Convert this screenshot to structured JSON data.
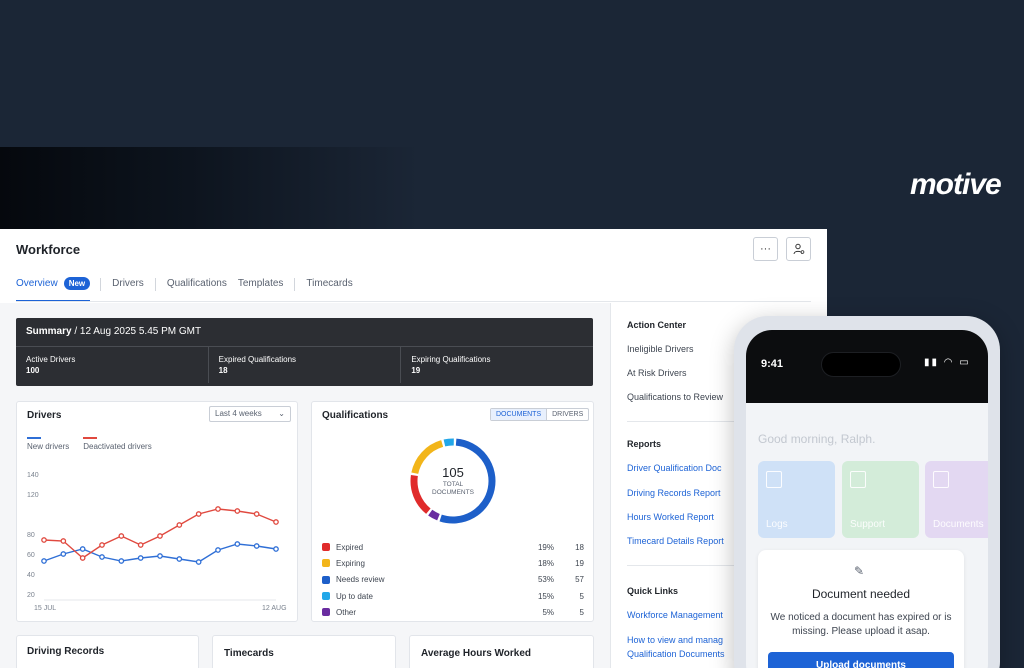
{
  "brand": {
    "logo_text": "motive"
  },
  "workforce": {
    "title": "Workforce",
    "more_label": "···",
    "tabs": [
      {
        "label": "Overview",
        "badge": "New",
        "active": true
      },
      {
        "label": "Drivers"
      },
      {
        "label": "Qualifications"
      },
      {
        "label": "Templates"
      },
      {
        "label": "Timecards"
      }
    ]
  },
  "summary": {
    "title": "Summary",
    "timestamp": " / 12 Aug 2025 5.45 PM GMT",
    "stats": [
      {
        "label": "Active Drivers",
        "value": "100"
      },
      {
        "label": "Expired Qualifications",
        "value": "18"
      },
      {
        "label": "Expiring Qualifications",
        "value": "19"
      }
    ]
  },
  "drivers_card": {
    "title": "Drivers",
    "range_select": "Last 4 weeks",
    "legend": [
      {
        "label": "New drivers",
        "color": "#2f6fd6"
      },
      {
        "label": "Deactivated drivers",
        "color": "#e0493f"
      }
    ]
  },
  "chart_data": {
    "type": "line",
    "title": "Drivers",
    "ylim": [
      20,
      140
    ],
    "y_ticks": [
      "140",
      "120",
      "80",
      "60",
      "40",
      "20"
    ],
    "x_tick_labels": [
      "15 JUL",
      "12 AUG"
    ],
    "grid": false,
    "legend_position": "top-left",
    "series": [
      {
        "name": "New drivers",
        "color": "#2f6fd6",
        "values": [
          53,
          60,
          65,
          57,
          53,
          56,
          58,
          55,
          52,
          64,
          70,
          68,
          65
        ]
      },
      {
        "name": "Deactivated drivers",
        "color": "#e0493f",
        "values": [
          74,
          73,
          56,
          69,
          78,
          69,
          78,
          89,
          100,
          105,
          103,
          100,
          92
        ]
      }
    ]
  },
  "qualifications_card": {
    "title": "Qualifications",
    "toggle": [
      "DOCUMENTS",
      "DRIVERS"
    ],
    "total_value": "105",
    "total_label_1": "TOTAL",
    "total_label_2": "DOCUMENTS",
    "rows": [
      {
        "name": "Expired",
        "pct": "19%",
        "count": "18",
        "color": "#e02b2b"
      },
      {
        "name": "Expiring",
        "pct": "18%",
        "count": "19",
        "color": "#f2b51a"
      },
      {
        "name": "Needs review",
        "pct": "53%",
        "count": "57",
        "color": "#1d5fc9"
      },
      {
        "name": "Up to date",
        "pct": "15%",
        "count": "5",
        "color": "#22a7e8"
      },
      {
        "name": "Other",
        "pct": "5%",
        "count": "5",
        "color": "#6a2ca0"
      }
    ]
  },
  "bottom_cards": {
    "driving_records": "Driving Records",
    "timecards": "Timecards",
    "avg_hours": "Average Hours Worked"
  },
  "sidebar": {
    "action_center": {
      "title": "Action Center",
      "items": [
        "Ineligible Drivers",
        "At Risk Drivers",
        "Qualifications to Review"
      ]
    },
    "reports": {
      "title": "Reports",
      "links": [
        "Driver Qualification Doc",
        "Driving Records Report",
        "Hours Worked Report",
        "Timecard Details Report"
      ]
    },
    "quick_links": {
      "title": "Quick Links",
      "links": [
        "Workforce Management",
        "How to view and manag",
        "Qualification Documents"
      ]
    }
  },
  "phone": {
    "time": "9:41",
    "status_icons": "▮▮ ◠ ▭",
    "greeting": "Good morning, Ralph.",
    "tiles": [
      {
        "label": "Logs",
        "color": "#cfe1f7"
      },
      {
        "label": "Support",
        "color": "#d3ecd9"
      },
      {
        "label": "Documents",
        "color": "#e3d8f2"
      }
    ],
    "doc_card": {
      "title": "Document needed",
      "body": "We noticed a document has expired or is missing. Please upload it asap.",
      "button": "Upload documents"
    }
  }
}
